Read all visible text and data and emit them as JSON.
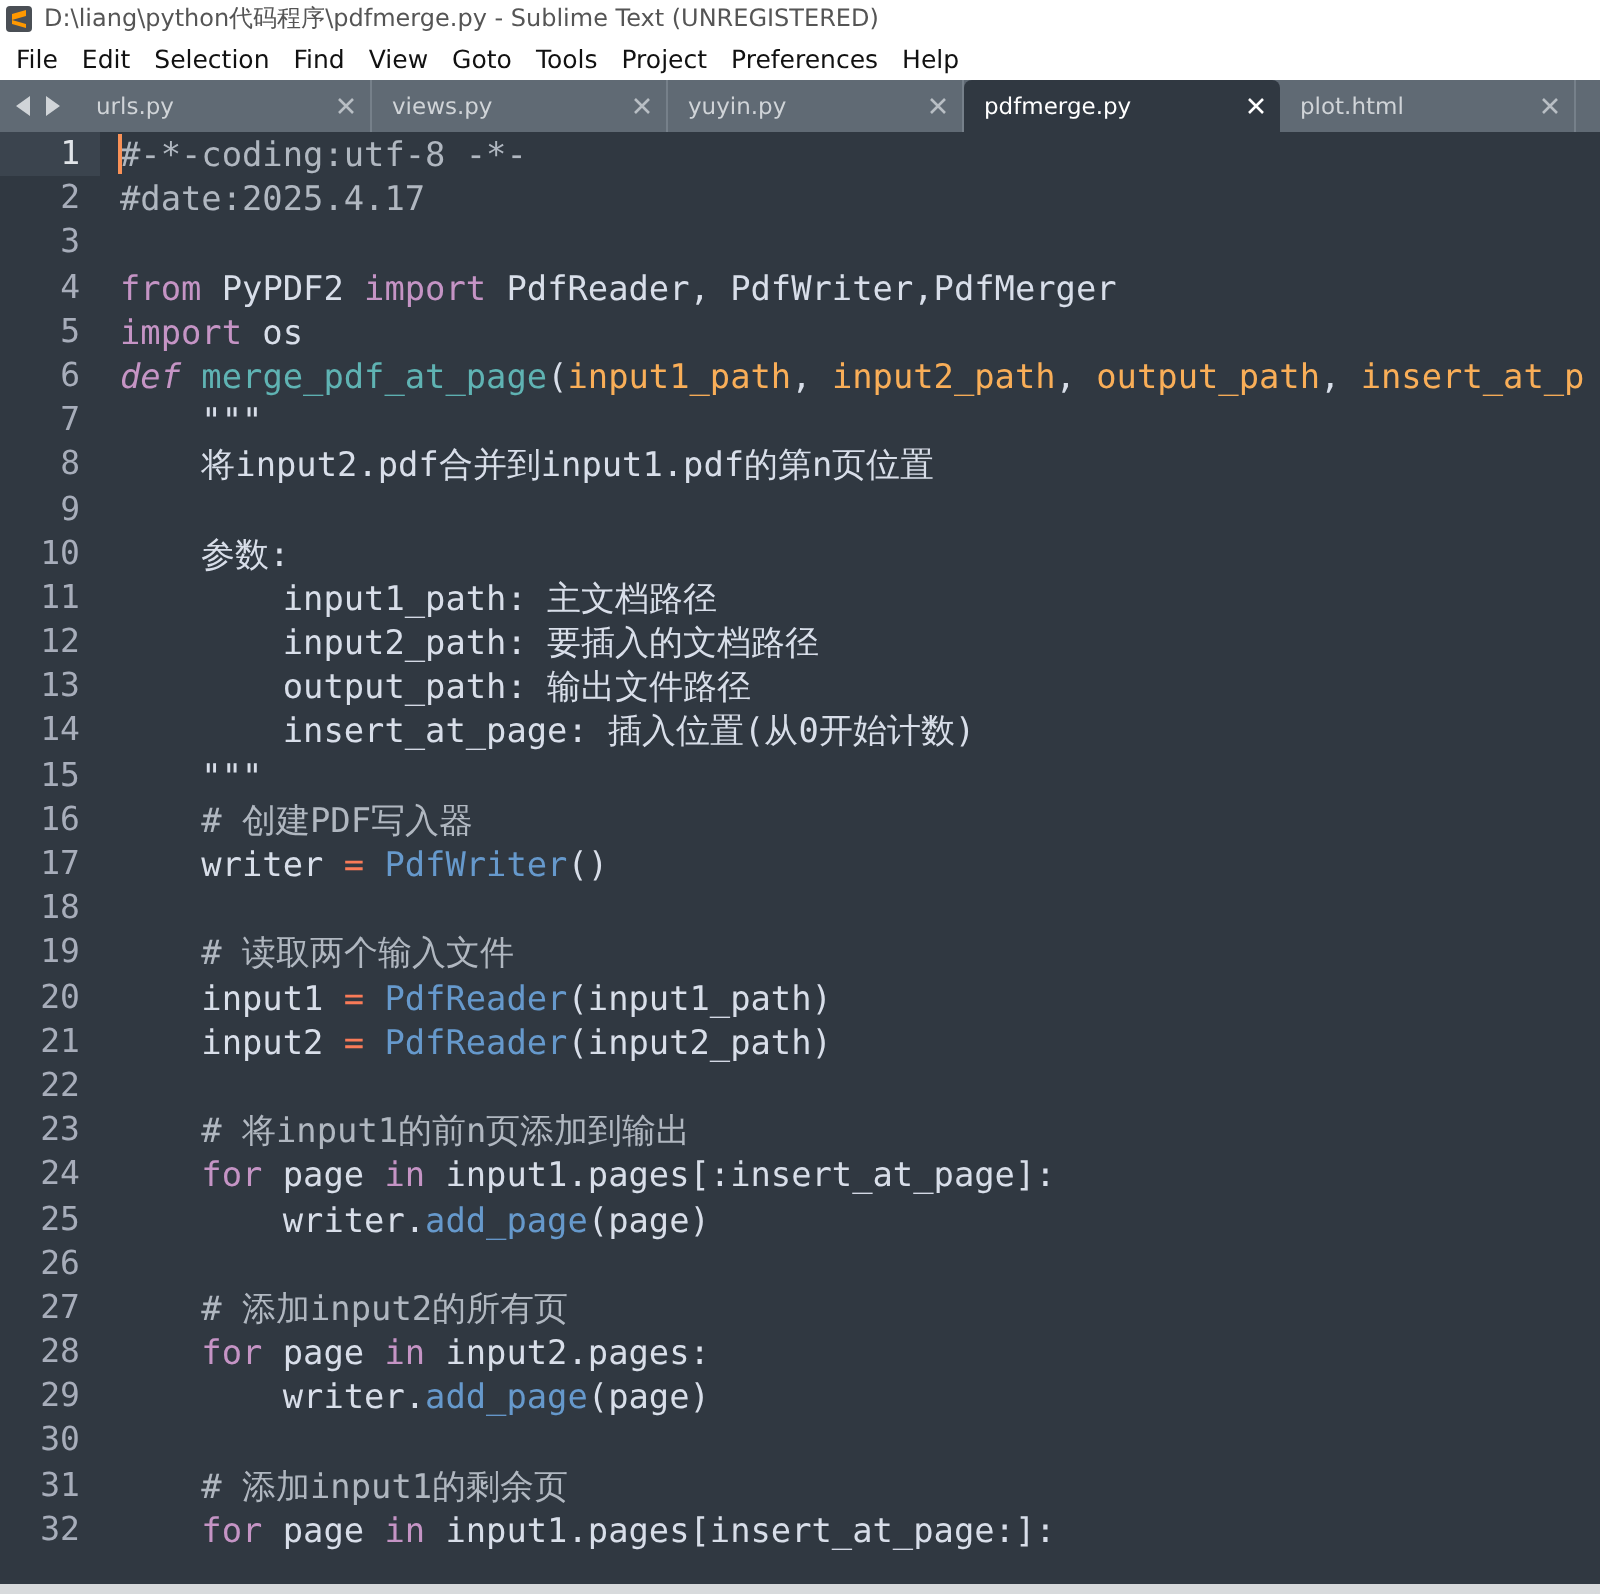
{
  "window": {
    "title": "D:\\liang\\python代码程序\\pdfmerge.py - Sublime Text (UNREGISTERED)"
  },
  "menu": [
    "File",
    "Edit",
    "Selection",
    "Find",
    "View",
    "Goto",
    "Tools",
    "Project",
    "Preferences",
    "Help"
  ],
  "tabs": [
    {
      "label": "urls.py",
      "selected": false
    },
    {
      "label": "views.py",
      "selected": false
    },
    {
      "label": "yuyin.py",
      "selected": false
    },
    {
      "label": "pdfmerge.py",
      "selected": true
    },
    {
      "label": "plot.html",
      "selected": false
    }
  ],
  "editor": {
    "lines": [
      {
        "number": "1",
        "current": true,
        "tokens": [
          {
            "kind": "comment",
            "text": "#-*-coding:utf-8 -*-"
          }
        ]
      },
      {
        "number": "2",
        "current": false,
        "tokens": [
          {
            "kind": "comment",
            "text": "#date:2025.4.17"
          }
        ]
      },
      {
        "number": "3",
        "current": false
      },
      {
        "number": "4",
        "current": false,
        "tokens": [
          {
            "kind": "keyword",
            "text": "from"
          },
          {
            "kind": "plain",
            "text": " PyPDF2 "
          },
          {
            "kind": "keyword",
            "text": "import"
          },
          {
            "kind": "plain",
            "text": " PdfReader, PdfWriter,PdfMerger"
          }
        ]
      },
      {
        "number": "5",
        "current": false,
        "tokens": [
          {
            "kind": "keyword",
            "text": "import"
          },
          {
            "kind": "plain",
            "text": " os"
          }
        ]
      },
      {
        "number": "6",
        "current": false,
        "tokens": [
          {
            "kind": "storage",
            "text": "def"
          },
          {
            "kind": "function",
            "text": " merge_pdf_at_page"
          },
          {
            "kind": "plain",
            "text": "("
          },
          {
            "kind": "param",
            "text": "input1_path"
          },
          {
            "kind": "plain",
            "text": ", "
          },
          {
            "kind": "param",
            "text": "input2_path"
          },
          {
            "kind": "plain",
            "text": ", "
          },
          {
            "kind": "param",
            "text": "output_path"
          },
          {
            "kind": "plain",
            "text": ", "
          },
          {
            "kind": "param",
            "text": "insert_at_p"
          }
        ]
      },
      {
        "number": "7",
        "current": false,
        "tokens": [
          {
            "kind": "plain",
            "text": "    \"\"\""
          }
        ]
      },
      {
        "number": "8",
        "current": false,
        "tokens": [
          {
            "kind": "plain",
            "text": "    将input2.pdf合并到input1.pdf的第n页位置"
          }
        ]
      },
      {
        "number": "9",
        "current": false
      },
      {
        "number": "10",
        "current": false,
        "tokens": [
          {
            "kind": "plain",
            "text": "    参数:"
          }
        ]
      },
      {
        "number": "11",
        "current": false,
        "tokens": [
          {
            "kind": "plain",
            "text": "        input1_path: 主文档路径"
          }
        ]
      },
      {
        "number": "12",
        "current": false,
        "tokens": [
          {
            "kind": "plain",
            "text": "        input2_path: 要插入的文档路径"
          }
        ]
      },
      {
        "number": "13",
        "current": false,
        "tokens": [
          {
            "kind": "plain",
            "text": "        output_path: 输出文件路径"
          }
        ]
      },
      {
        "number": "14",
        "current": false,
        "tokens": [
          {
            "kind": "plain",
            "text": "        insert_at_page: 插入位置(从0开始计数)"
          }
        ]
      },
      {
        "number": "15",
        "current": false,
        "tokens": [
          {
            "kind": "plain",
            "text": "    \"\"\""
          }
        ]
      },
      {
        "number": "16",
        "current": false,
        "tokens": [
          {
            "kind": "comment",
            "text": "    # 创建PDF写入器"
          }
        ]
      },
      {
        "number": "17",
        "current": false,
        "tokens": [
          {
            "kind": "plain",
            "text": "    writer "
          },
          {
            "kind": "operator",
            "text": "="
          },
          {
            "kind": "call",
            "text": " PdfWriter"
          },
          {
            "kind": "plain",
            "text": "()"
          }
        ]
      },
      {
        "number": "18",
        "current": false
      },
      {
        "number": "19",
        "current": false,
        "tokens": [
          {
            "kind": "comment",
            "text": "    # 读取两个输入文件"
          }
        ]
      },
      {
        "number": "20",
        "current": false,
        "tokens": [
          {
            "kind": "plain",
            "text": "    input1 "
          },
          {
            "kind": "operator",
            "text": "="
          },
          {
            "kind": "call",
            "text": " PdfReader"
          },
          {
            "kind": "plain",
            "text": "(input1_path)"
          }
        ]
      },
      {
        "number": "21",
        "current": false,
        "tokens": [
          {
            "kind": "plain",
            "text": "    input2 "
          },
          {
            "kind": "operator",
            "text": "="
          },
          {
            "kind": "call",
            "text": " PdfReader"
          },
          {
            "kind": "plain",
            "text": "(input2_path)"
          }
        ]
      },
      {
        "number": "22",
        "current": false
      },
      {
        "number": "23",
        "current": false,
        "tokens": [
          {
            "kind": "comment",
            "text": "    # 将input1的前n页添加到输出"
          }
        ]
      },
      {
        "number": "24",
        "current": false,
        "tokens": [
          {
            "kind": "keyword",
            "text": "    for"
          },
          {
            "kind": "plain",
            "text": " page "
          },
          {
            "kind": "keyword",
            "text": "in"
          },
          {
            "kind": "plain",
            "text": " input1.pages[:insert_at_page]:"
          }
        ]
      },
      {
        "number": "25",
        "current": false,
        "tokens": [
          {
            "kind": "plain",
            "text": "        writer."
          },
          {
            "kind": "call",
            "text": "add_page"
          },
          {
            "kind": "plain",
            "text": "(page)"
          }
        ]
      },
      {
        "number": "26",
        "current": false
      },
      {
        "number": "27",
        "current": false,
        "tokens": [
          {
            "kind": "comment",
            "text": "    # 添加input2的所有页"
          }
        ]
      },
      {
        "number": "28",
        "current": false,
        "tokens": [
          {
            "kind": "keyword",
            "text": "    for"
          },
          {
            "kind": "plain",
            "text": " page "
          },
          {
            "kind": "keyword",
            "text": "in"
          },
          {
            "kind": "plain",
            "text": " input2.pages:"
          }
        ]
      },
      {
        "number": "29",
        "current": false,
        "tokens": [
          {
            "kind": "plain",
            "text": "        writer."
          },
          {
            "kind": "call",
            "text": "add_page"
          },
          {
            "kind": "plain",
            "text": "(page)"
          }
        ]
      },
      {
        "number": "30",
        "current": false
      },
      {
        "number": "31",
        "current": false,
        "tokens": [
          {
            "kind": "comment",
            "text": "    # 添加input1的剩余页"
          }
        ]
      },
      {
        "number": "32",
        "current": false,
        "tokens": [
          {
            "kind": "keyword",
            "text": "    for"
          },
          {
            "kind": "plain",
            "text": " page "
          },
          {
            "kind": "keyword",
            "text": "in"
          },
          {
            "kind": "plain",
            "text": " input1.pages[insert_at_page:]:"
          }
        ]
      }
    ]
  }
}
